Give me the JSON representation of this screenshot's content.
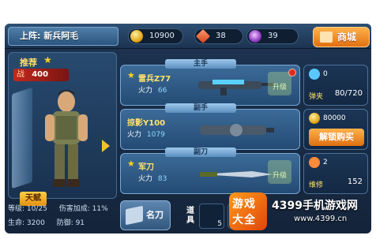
{
  "topbar": {
    "team_title": "上阵: 新兵阿毛",
    "gold": "10900",
    "gems": "38",
    "crystals": "39",
    "shop_label": "商城"
  },
  "hero": {
    "recommend": "推荐",
    "power_label": "战",
    "power_value": "400",
    "talent_label": "天赋"
  },
  "stats": {
    "level": "等级: 10/25",
    "damage_bonus": "伤害加成: 11%",
    "health": "生命: 3200",
    "defense": "防御: 91"
  },
  "weapons": [
    {
      "slot_tag": "主手",
      "name": "雷兵Z77",
      "fire_label": "火力",
      "fire_value": "66",
      "upgrade": "升级"
    },
    {
      "slot_tag": "副手",
      "name": "掠影Y100",
      "fire_label": "火力",
      "fire_value": "1079"
    },
    {
      "slot_tag": "副刀",
      "name": "军刀",
      "fire_label": "火力",
      "fire_value": "83",
      "upgrade": "升级"
    }
  ],
  "side": {
    "ammo_count": "0",
    "ammo_label": "弹夹",
    "ammo_value": "80/720",
    "unlock_cost": "80000",
    "unlock_label": "解锁购买",
    "repair_count": "2",
    "repair_label": "维修",
    "repair_value": "152"
  },
  "bottom": {
    "legend_label": "名刀",
    "item_label": "道具",
    "item_count": "5"
  },
  "logo": {
    "badge_line1": "游戏",
    "badge_line2": "大全",
    "site": "4399手机游戏网",
    "url": "www.4399.cn"
  },
  "colors": {
    "accent": "#e07012",
    "panel": "#244b74",
    "gold": "#ffd21a"
  }
}
